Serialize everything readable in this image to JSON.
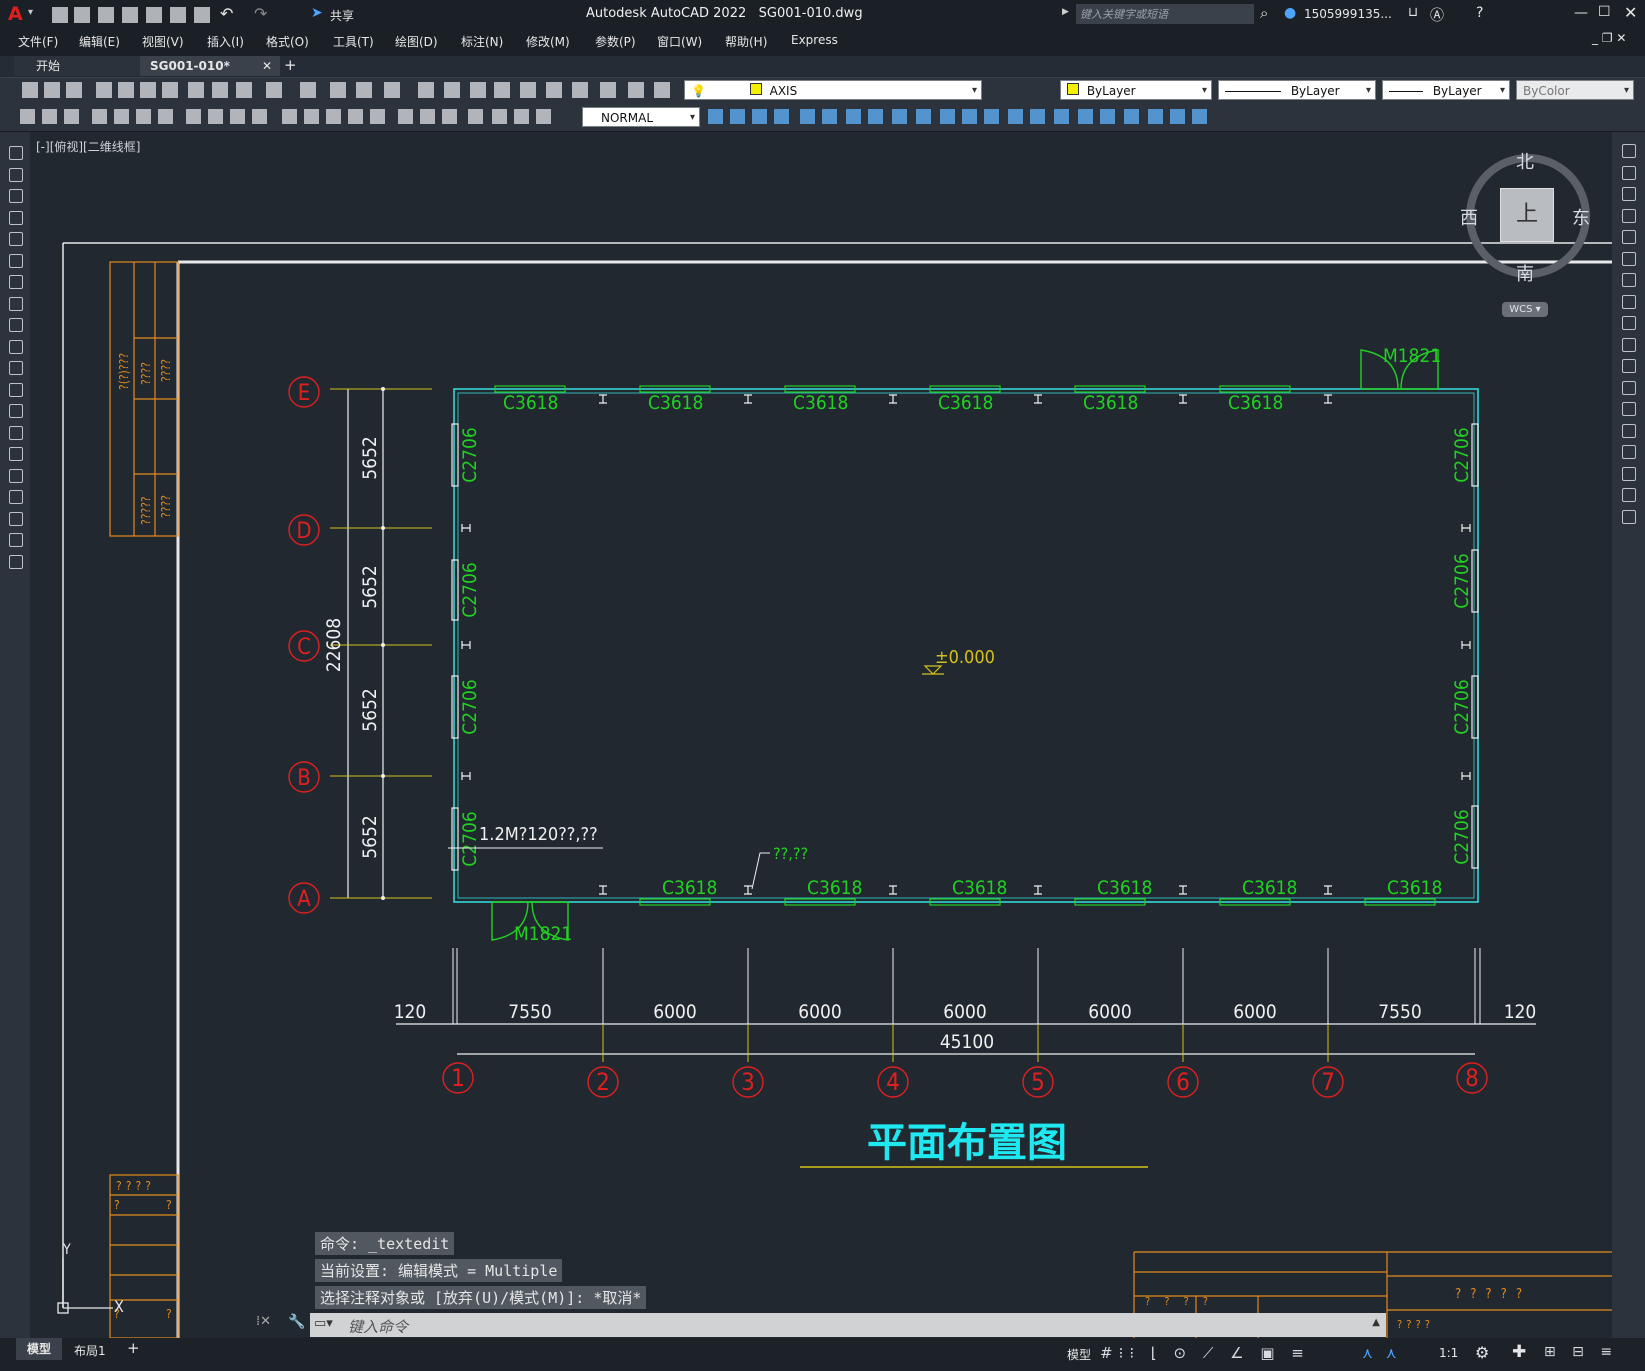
{
  "app": {
    "title": "Autodesk AutoCAD 2022",
    "file": "SG001-010.dwg",
    "share_label": "共享",
    "search_placeholder": "键入关键字或短语",
    "user": "1505999135...",
    "logo": "A"
  },
  "menu": [
    "文件(F)",
    "编辑(E)",
    "视图(V)",
    "插入(I)",
    "格式(O)",
    "工具(T)",
    "绘图(D)",
    "标注(N)",
    "修改(M)",
    "参数(P)",
    "窗口(W)",
    "帮助(H)",
    "Express"
  ],
  "tabs": {
    "start": "开始",
    "drawing": "SG001-010*",
    "add": "+"
  },
  "toolbar": {
    "layer": "AXIS",
    "color": "ByLayer",
    "linetype": "ByLayer",
    "lineweight": "ByLayer",
    "plotstyle": "ByColor",
    "dimstyle": "NORMAL"
  },
  "viewport": {
    "label": "[-][俯视][二维线框]"
  },
  "viewcube": {
    "north": "北",
    "south": "南",
    "east": "东",
    "west": "西",
    "top": "上",
    "wcs": "WCS"
  },
  "drawing": {
    "title": "平面布置图",
    "axes_h": [
      "①",
      "②",
      "③",
      "④",
      "⑤",
      "⑥",
      "⑦",
      "⑧"
    ],
    "axes_v": [
      "E",
      "D",
      "C",
      "B",
      "A"
    ],
    "dims_bottom": [
      "120",
      "7550",
      "6000",
      "6000",
      "6000",
      "6000",
      "6000",
      "7550",
      "120"
    ],
    "dim_total": "45100",
    "dims_left": [
      "5652",
      "5652",
      "5652",
      "5652"
    ],
    "dim_left_total": "22608",
    "window_top": "C3618",
    "window_side": "C2706",
    "door": "M1821",
    "elevation": "±0.000",
    "note1": "1.2M?120??,??",
    "note2": "??,??",
    "qmarks": "????",
    "qmark": "?",
    "qmarks5": "?????",
    "qmarks_vert": "?(?)???"
  },
  "command": {
    "lines": [
      "命令: _textedit",
      "当前设置: 编辑模式 = Multiple",
      "选择注释对象或 [放弃(U)/模式(M)]: *取消*"
    ],
    "placeholder": "键入命令"
  },
  "layout_tabs": [
    "模型",
    "布局1",
    "+"
  ],
  "status": {
    "model": "模型",
    "scale": "1:1"
  },
  "colors": {
    "bg": "#212830",
    "wall": "#35d6d6",
    "window": "#22d022",
    "axis": "#e02020",
    "dim": "#f0f0f0",
    "frame": "#e38a1d",
    "title": "#20e8f0",
    "leader": "#d4c21a"
  }
}
